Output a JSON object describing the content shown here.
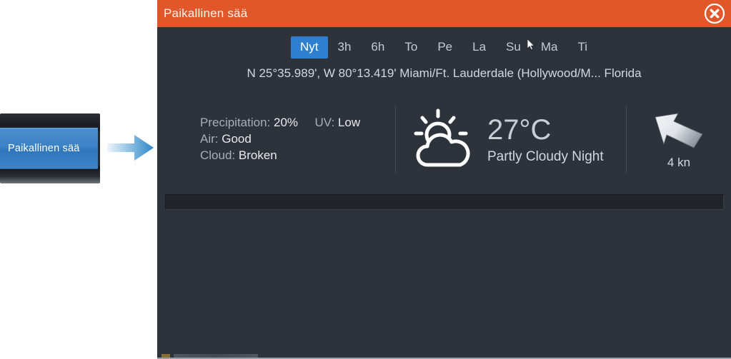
{
  "callout": {
    "menu_button_label": "Paikallinen sää",
    "arrow_icon": "right-arrow-icon",
    "accent_blue": "#3b82c6"
  },
  "panel": {
    "title": "Paikallinen sää",
    "header_color": "#e2572a",
    "body_color": "#2e333b",
    "close_icon": "close-circle-icon",
    "tabs": [
      {
        "label": "Nyt",
        "selected": true
      },
      {
        "label": "3h",
        "selected": false
      },
      {
        "label": "6h",
        "selected": false
      },
      {
        "label": "To",
        "selected": false
      },
      {
        "label": "Pe",
        "selected": false
      },
      {
        "label": "La",
        "selected": false
      },
      {
        "label": "Su",
        "selected": false
      },
      {
        "label": "Ma",
        "selected": false
      },
      {
        "label": "Ti",
        "selected": false
      }
    ],
    "selected_tab_color": "#2f7fd0",
    "cursor_icon": "mouse-pointer-icon",
    "location": "N  25°35.989', W  80°13.419' Miami/Ft. Lauderdale (Hollywood/M... Florida",
    "details": {
      "precipitation_label": "Precipitation:",
      "precipitation_value": "20%",
      "uv_label": "UV:",
      "uv_value": "Low",
      "air_label": "Air:",
      "air_value": "Good",
      "cloud_label": "Cloud:",
      "cloud_value": "Broken"
    },
    "current": {
      "weather_icon": "sun-behind-cloud-icon",
      "temperature": "27°C",
      "condition": "Partly Cloudy Night"
    },
    "wind": {
      "arrow_icon": "wind-direction-arrow-icon",
      "speed": "4 kn"
    }
  }
}
